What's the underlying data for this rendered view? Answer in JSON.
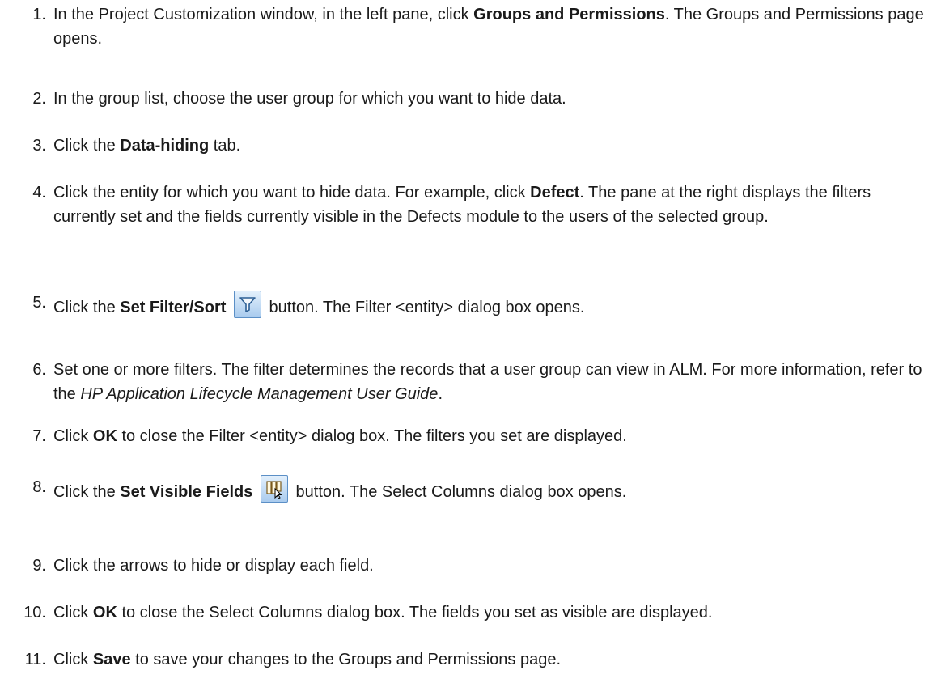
{
  "steps": [
    {
      "num": "1.",
      "parts": [
        {
          "t": "In the Project Customization window, in the left pane, click "
        },
        {
          "b": "Groups and Permissions"
        },
        {
          "t": ". The Groups and Permissions page opens."
        }
      ]
    },
    {
      "num": "2.",
      "parts": [
        {
          "t": "In the group list, choose the user group for which you want to hide data."
        }
      ]
    },
    {
      "num": "3.",
      "parts": [
        {
          "t": "Click the "
        },
        {
          "b": "Data-hiding"
        },
        {
          "t": " tab."
        }
      ]
    },
    {
      "num": "4.",
      "parts": [
        {
          "t": "Click the entity for which you want to hide data. For example, click "
        },
        {
          "b": "Defect"
        },
        {
          "t": ". The pane at the right displays the filters currently set and the fields currently visible in the Defects module to the users of the selected group."
        }
      ]
    },
    {
      "num": "5.",
      "parts": [
        {
          "t": "Click the "
        },
        {
          "b": "Set Filter/Sort"
        },
        {
          "t": " "
        },
        {
          "icon": "filter-icon"
        },
        {
          "t": " button. The Filter <entity> dialog box opens."
        }
      ]
    },
    {
      "num": "6.",
      "parts": [
        {
          "t": "Set one or more filters. The filter determines the records that a user group can view in ALM. For more information, refer to the "
        },
        {
          "i": "HP Application Lifecycle Management User Guide"
        },
        {
          "t": "."
        }
      ]
    },
    {
      "num": "7.",
      "parts": [
        {
          "t": "Click "
        },
        {
          "b": "OK"
        },
        {
          "t": " to close the Filter <entity> dialog box. The filters you set are displayed."
        }
      ]
    },
    {
      "num": "8.",
      "parts": [
        {
          "t": "Click the "
        },
        {
          "b": "Set Visible Fields"
        },
        {
          "t": " "
        },
        {
          "icon": "select-columns-icon"
        },
        {
          "t": " button. The Select Columns dialog box opens."
        }
      ]
    },
    {
      "num": "9.",
      "parts": [
        {
          "t": "Click the arrows to hide or display each field."
        }
      ]
    },
    {
      "num": "10.",
      "parts": [
        {
          "t": "Click "
        },
        {
          "b": "OK"
        },
        {
          "t": " to close the Select Columns dialog box. The fields you set as visible are displayed."
        }
      ]
    },
    {
      "num": "11.",
      "parts": [
        {
          "t": "Click "
        },
        {
          "b": "Save"
        },
        {
          "t": " to save your changes to the Groups and Permissions page."
        }
      ]
    }
  ]
}
